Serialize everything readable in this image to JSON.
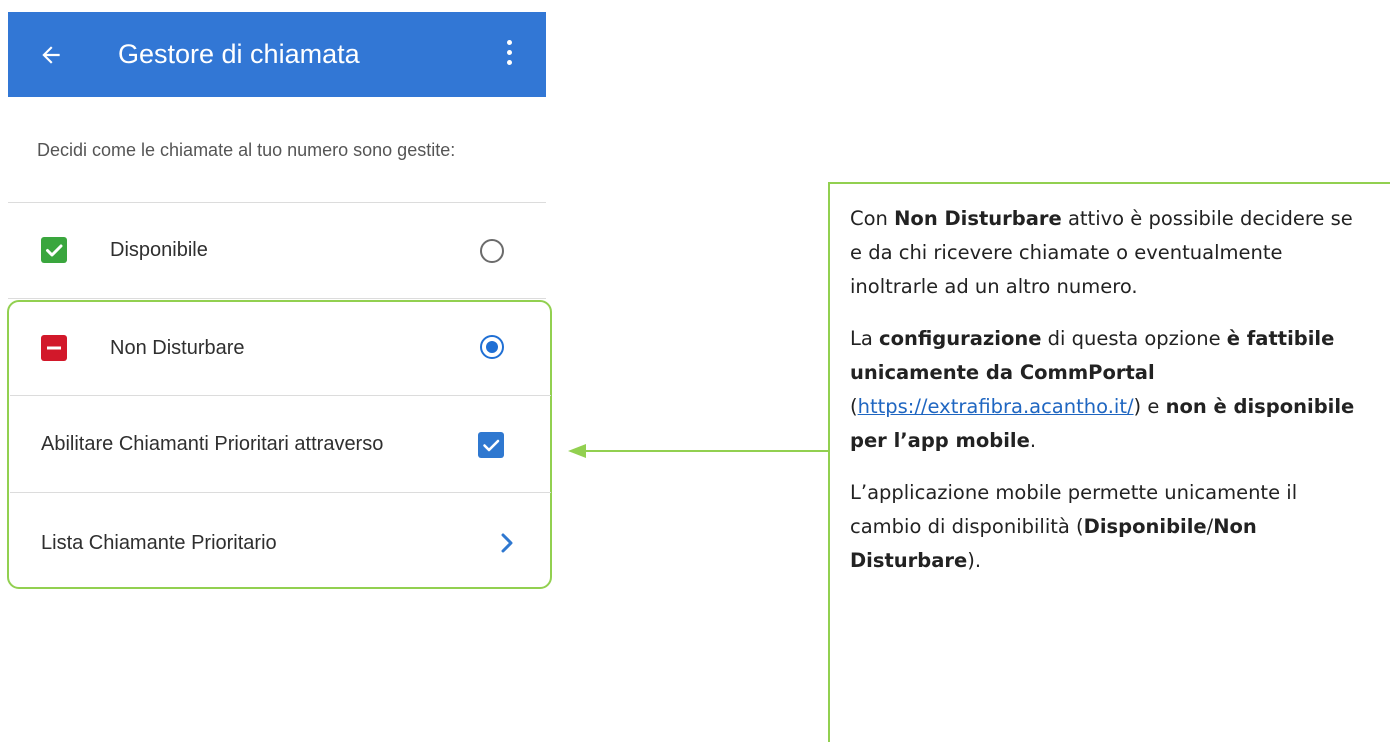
{
  "appbar": {
    "title": "Gestore di chiamata",
    "back_icon": "arrow-left-icon",
    "menu_icon": "more-vertical-icon",
    "color": "#3277d5"
  },
  "subtitle": "Decidi come le chiamate al tuo numero sono gestite:",
  "options": [
    {
      "label": "Disponibile",
      "icon": "check-square-icon",
      "icon_color": "#3aa63e",
      "selected": false
    },
    {
      "label": "Non Disturbare",
      "icon": "minus-square-icon",
      "icon_color": "#d2182a",
      "selected": true
    }
  ],
  "priority_callers": {
    "label": "Abilitare Chiamanti Prioritari attraverso",
    "checked": true
  },
  "priority_list": {
    "label": "Lista Chiamante Prioritario",
    "icon": "chevron-right-icon"
  },
  "callout": {
    "p1": {
      "pre": "Con ",
      "bold": "Non Disturbare",
      "post": " attivo è possibile decidere se e da chi ricevere chiamate o eventualmente inoltrarle ad un altro numero."
    },
    "p2": {
      "t1": "La ",
      "b1": "configurazione",
      "t2": " di questa opzione ",
      "b2": "è fattibile unicamente da CommPortal",
      "t3": " (",
      "link": "https://extrafibra.acantho.it/",
      "t4": ") e ",
      "b3": "non è disponibile per l’app mobile",
      "t5": "."
    },
    "p3": {
      "t1": "L’applicazione mobile permette unicamente il cambio di disponibilità (",
      "b1": "Disponibile",
      "t2": "/",
      "b2": "Non Disturbare",
      "t3": ")."
    }
  },
  "colors": {
    "highlight": "#92d050",
    "link": "#1f66c1",
    "radio_selected": "#1f6fd4"
  }
}
